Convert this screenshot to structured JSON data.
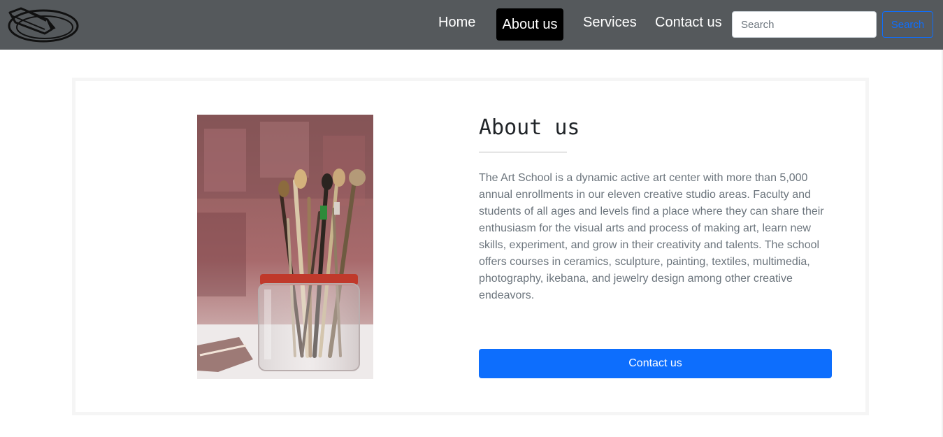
{
  "header": {
    "logo_icon": "paintbrush-palette-logo-icon",
    "nav": {
      "home": "Home",
      "about": "About us",
      "services": "Services",
      "contact": "Contact us"
    },
    "search": {
      "placeholder": "Search",
      "value": "",
      "button_label": "Search"
    }
  },
  "main": {
    "heading": "About us",
    "image_icon": "paintbrush-jar-photo",
    "description": "The Art School is a dynamic active art center with more than 5,000 annual enrollments in our eleven creative studio areas. Faculty and students of all ages and levels find a place where they can share their enthusiasm for the visual arts and process of making art, learn new skills, experiment, and grow in their creativity and talents. The school offers courses in ceramics, sculpture, painting, textiles, multimedia, photography, ikebana, and jewelry design among other creative endeavors.",
    "contact_button_label": "Contact us"
  },
  "colors": {
    "navbar_bg": "#55595c",
    "active_nav_bg": "#000000",
    "primary": "#0d6efd",
    "muted_text": "#6c757d"
  }
}
